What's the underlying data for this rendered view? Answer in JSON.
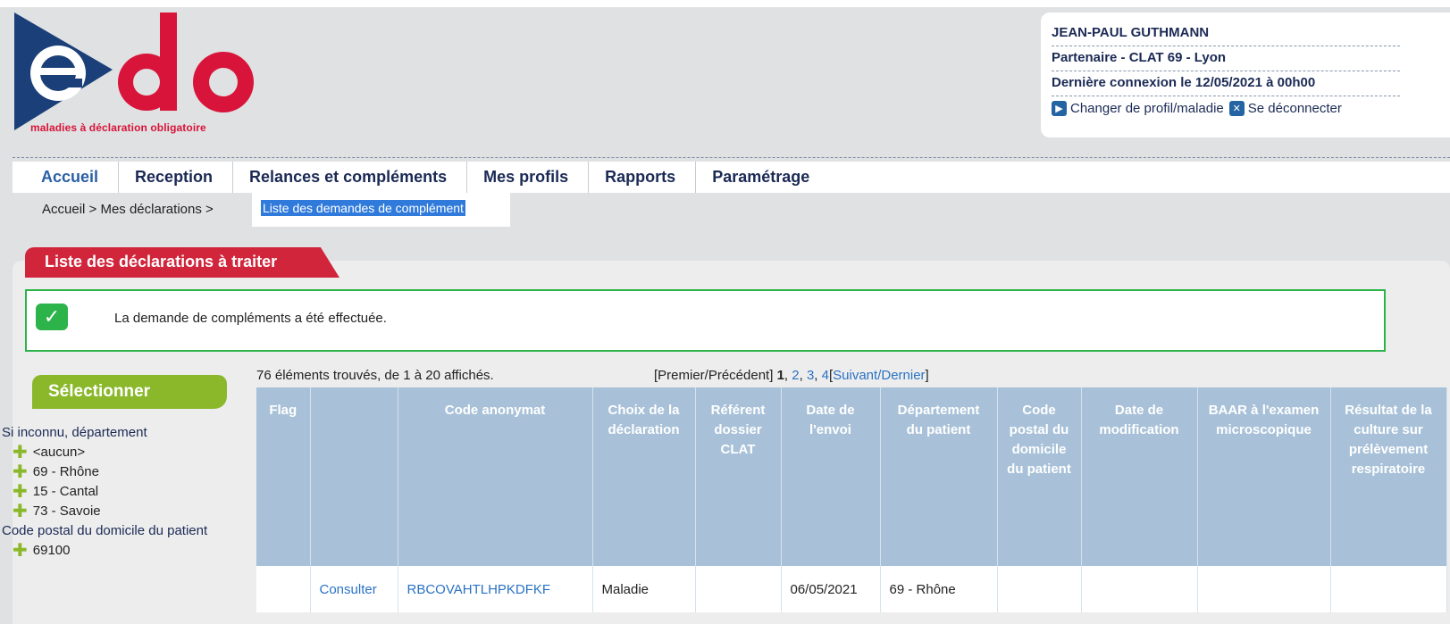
{
  "logo": {
    "text": "edo",
    "tagline": "maladies à déclaration obligatoire"
  },
  "user": {
    "name": "JEAN-PAUL GUTHMANN",
    "partner": "Partenaire - CLAT 69 - Lyon",
    "last_login": "Dernière connexion le 12/05/2021 à 00h00",
    "change_profile": "Changer de profil/maladie",
    "logout": "Se déconnecter"
  },
  "nav": {
    "items": [
      "Accueil",
      "Reception",
      "Relances et compléments",
      "Mes profils",
      "Rapports",
      "Paramétrage"
    ],
    "submenu_selected": "Liste des demandes de complément"
  },
  "breadcrumb": "Accueil > Mes déclarations >",
  "section_title": "Liste des déclarations à traiter",
  "alert": "La demande de compléments a été effectuée.",
  "sidebar": {
    "title": "Sélectionner",
    "group1_label": "Si inconnu, département",
    "group1_options": [
      "<aucun>",
      "69 - Rhône",
      "15 - Cantal",
      "73 - Savoie"
    ],
    "group2_label": "Code postal du domicile du patient",
    "group2_options": [
      "69100"
    ]
  },
  "results": {
    "count_text": "76 éléments trouvés, de 1 à 20 affichés.",
    "pager_prefix": "[Premier/Précédent] ",
    "pager_current": "1",
    "pager_sep1": ", ",
    "page2": "2",
    "pager_sep2": ", ",
    "page3": "3",
    "pager_sep3": ", ",
    "page4": "4",
    "pager_open": "[",
    "next": "Suivant",
    "pager_slash": "/",
    "last": "Dernier",
    "pager_close": "]"
  },
  "table": {
    "headers": {
      "flag": "Flag",
      "action": "",
      "code": "Code anonymat",
      "choix": "Choix de la déclaration",
      "referent": "Référent dossier CLAT",
      "date_envoi": "Date de l'envoi",
      "departement": "Département du patient",
      "code_postal": "Code postal du domicile du patient",
      "date_modif": "Date de modification",
      "baar": "BAAR à l'examen microscopique",
      "resultat": "Résultat de la culture sur prélèvement respiratoire"
    },
    "row1": {
      "flag": "",
      "action": "Consulter",
      "code": "RBCOVAHTLHPKDFKF",
      "choix": "Maladie",
      "referent": "",
      "date_envoi": "06/05/2021",
      "departement": "69 - Rhône",
      "code_postal": "",
      "date_modif": "",
      "baar": "",
      "resultat": ""
    }
  },
  "colors": {
    "accent_red": "#d1253b",
    "accent_green": "#8ab82a",
    "navy": "#1b2a55",
    "link": "#2a72c4",
    "table_header": "#a8c1d8"
  }
}
